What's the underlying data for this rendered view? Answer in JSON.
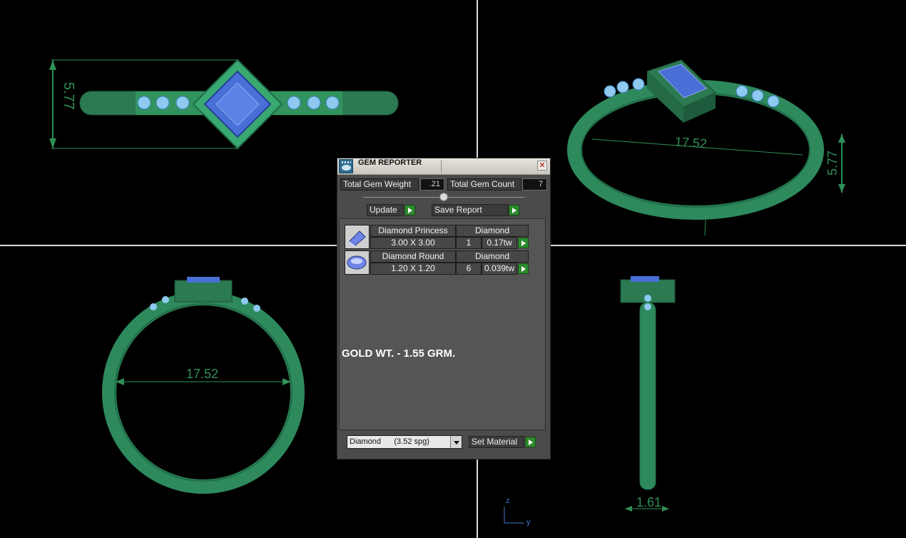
{
  "viewports": {
    "top_left": {
      "dim_height": "5.77"
    },
    "top_right": {
      "dim_width": "17.52",
      "dim_height": "5.77"
    },
    "bottom_left": {
      "dim_width": "17.52"
    },
    "bottom_right": {
      "dim_width": "1.61"
    },
    "axis": {
      "z": "z",
      "y": "y"
    }
  },
  "gem_reporter": {
    "title": "GEM REPORTER",
    "total_gem_weight_label": "Total Gem Weight",
    "total_gem_weight_value": ".21",
    "total_gem_count_label": "Total Gem Count",
    "total_gem_count_value": "7",
    "update_label": "Update",
    "save_report_label": "Save Report",
    "gems": [
      {
        "name": "Diamond Princess",
        "material": "Diamond",
        "size": "3.00 X 3.00",
        "count": "1",
        "weight": "0.17tw",
        "icon": "princess-cut-gem-icon"
      },
      {
        "name": "Diamond Round",
        "material": "Diamond",
        "size": "1.20 X 1.20",
        "count": "6",
        "weight": "0.039tw",
        "icon": "round-cut-gem-icon"
      }
    ],
    "gold_note": "GOLD WT. - 1.55 GRM.",
    "material_select": "Diamond      (3.52 spg)",
    "set_material_label": "Set Material"
  },
  "colors": {
    "background": "#000000",
    "ring_green": "#2e8a5c",
    "gem_blue": "#4a6fd6",
    "accent_blue": "#7fb6e8",
    "dimension_green": "#2f8f56"
  }
}
